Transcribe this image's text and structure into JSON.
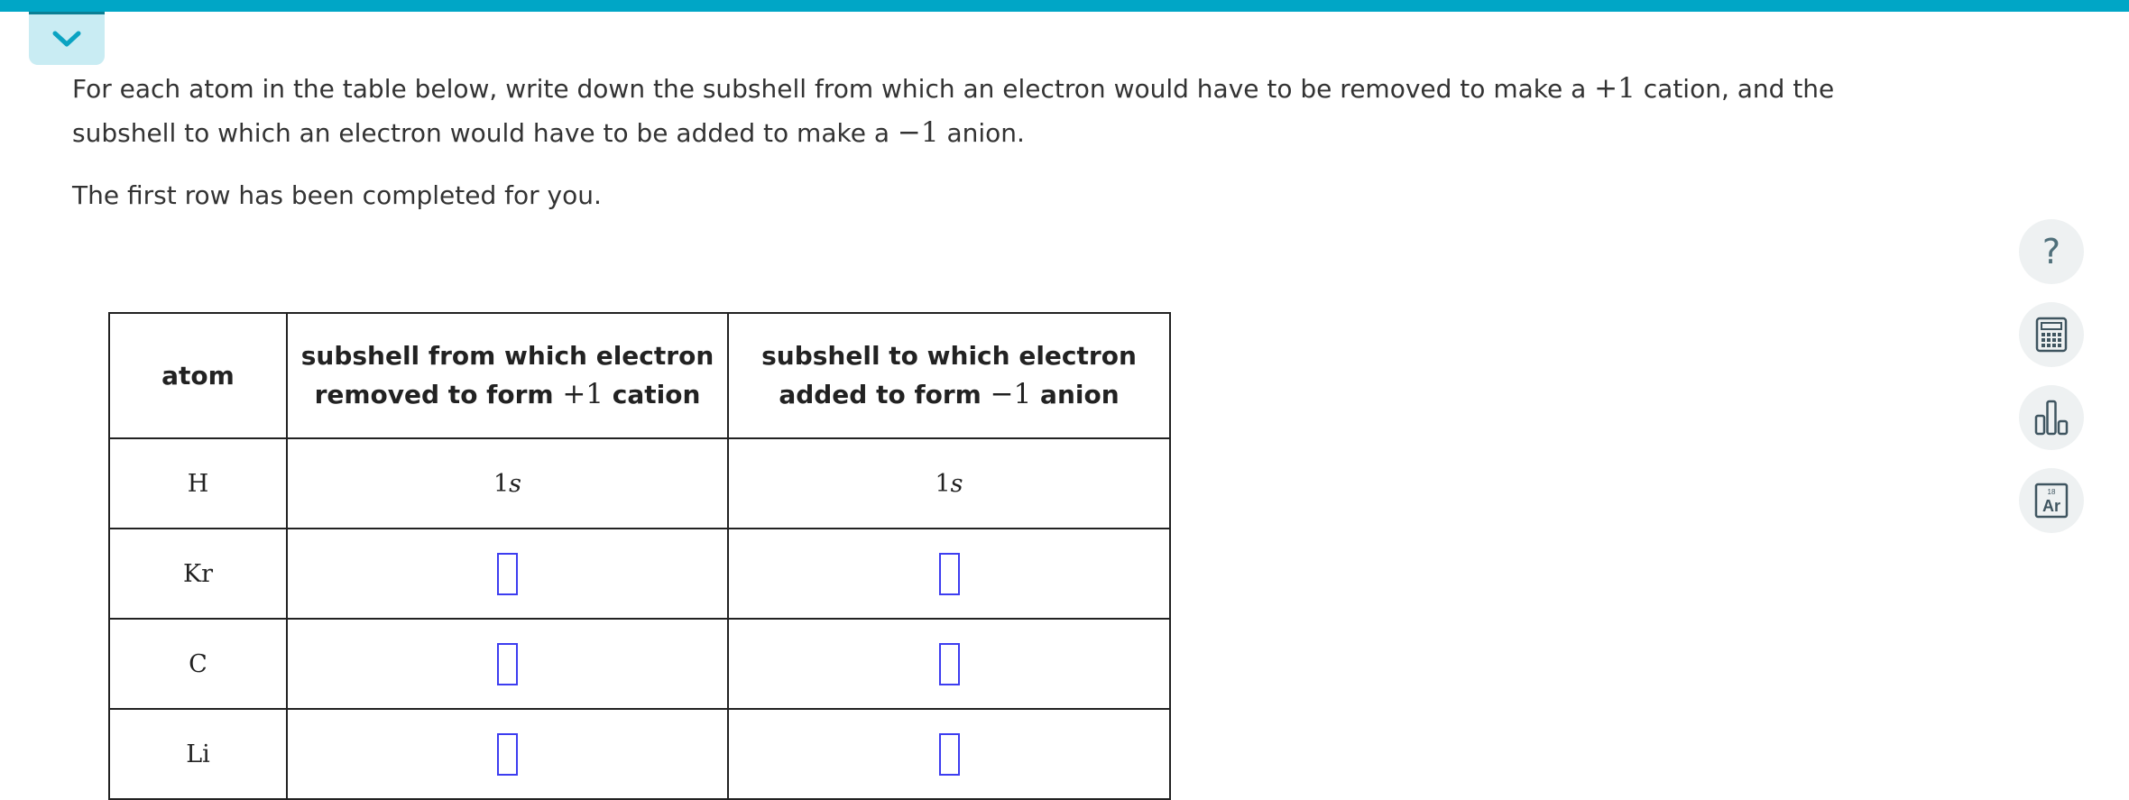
{
  "header": {
    "collapse_icon": "chevron-down-icon",
    "accent": "#00a6c6"
  },
  "prompt": {
    "part1": "For each atom in the table below, write down the subshell from which an electron would have to be removed to make a ",
    "plus_one": "+1",
    "part2": " cation, and the subshell to which an electron would have to be added to make a ",
    "minus_one": "−1",
    "part3": " anion.",
    "second_paragraph": "The first row has been completed for you."
  },
  "table": {
    "headers": {
      "atom": "atom",
      "removed_pre": "subshell from which electron removed to form ",
      "removed_charge": "+1",
      "removed_post": " cation",
      "added_pre": "subshell to which electron added to form ",
      "added_charge": "−1",
      "added_post": " anion"
    },
    "rows": [
      {
        "atom": "H",
        "removed_num": "1",
        "removed_letter": "s",
        "added_num": "1",
        "added_letter": "s"
      },
      {
        "atom": "Kr",
        "removed": "",
        "added": ""
      },
      {
        "atom": "C",
        "removed": "",
        "added": ""
      },
      {
        "atom": "Li",
        "removed": "",
        "added": ""
      }
    ]
  },
  "tools": [
    {
      "name": "help",
      "icon": "question-mark-icon",
      "label": "?"
    },
    {
      "name": "calculator",
      "icon": "calculator-icon"
    },
    {
      "name": "data",
      "icon": "bar-chart-icon"
    },
    {
      "name": "periodic-table",
      "icon": "periodic-table-icon",
      "number": "18",
      "symbol": "Ar"
    }
  ]
}
